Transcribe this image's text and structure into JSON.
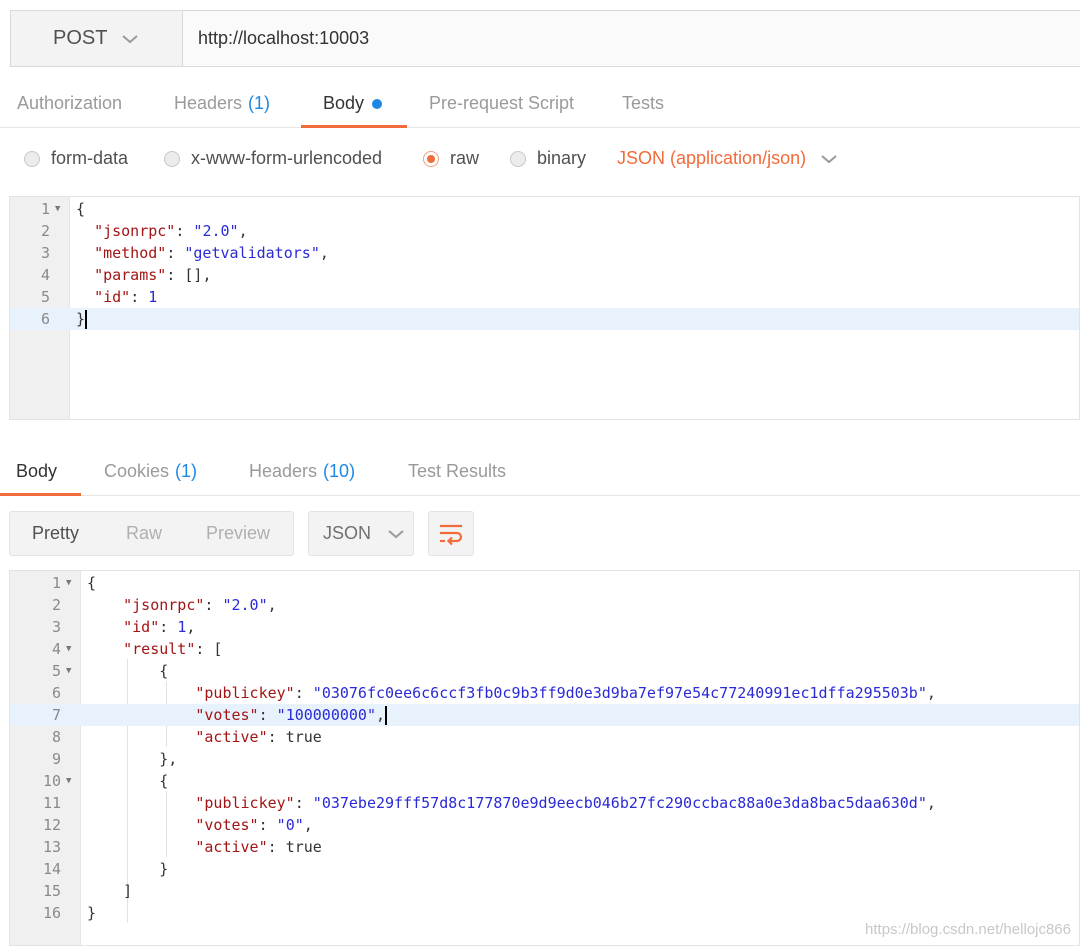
{
  "request": {
    "method": "POST",
    "url": "http://localhost:10003",
    "tabs": [
      {
        "label": "Authorization",
        "count": ""
      },
      {
        "label": "Headers",
        "count": "(1)"
      },
      {
        "label": "Body",
        "count": ""
      },
      {
        "label": "Pre-request Script",
        "count": ""
      },
      {
        "label": "Tests",
        "count": ""
      }
    ],
    "active_tab": "Body",
    "body_types": [
      "form-data",
      "x-www-form-urlencoded",
      "raw",
      "binary"
    ],
    "selected_body_type": "raw",
    "content_type": "JSON (application/json)",
    "body_lines": [
      "1",
      "2",
      "3",
      "4",
      "5",
      "6"
    ]
  },
  "response": {
    "tabs": [
      {
        "label": "Body",
        "count": ""
      },
      {
        "label": "Cookies",
        "count": "(1)"
      },
      {
        "label": "Headers",
        "count": "(10)"
      },
      {
        "label": "Test Results",
        "count": ""
      }
    ],
    "active_tab": "Body",
    "view_modes": [
      "Pretty",
      "Raw",
      "Preview"
    ],
    "active_view": "Pretty",
    "format": "JSON",
    "body_lines": [
      "1",
      "2",
      "3",
      "4",
      "5",
      "6",
      "7",
      "8",
      "9",
      "10",
      "11",
      "12",
      "13",
      "14",
      "15",
      "16"
    ],
    "values": {
      "jsonrpc": "2.0",
      "id": "1",
      "validators": [
        {
          "publickey": "03076fc0ee6c6ccf3fb0c9b3ff9d0e3d9ba7ef97e54c77240991ec1dffa295503b",
          "votes": "100000000",
          "active": "true"
        },
        {
          "publickey": "037ebe29fff57d8c177870e9d9eecb046b27fc290ccbac88a0e3da8bac5daa630d",
          "votes": "0",
          "active": "true"
        }
      ]
    }
  },
  "request_body": {
    "jsonrpc": "2.0",
    "method": "getvalidators",
    "params": "[]",
    "id": "1"
  },
  "watermark": "https://blog.csdn.net/hellojc866",
  "colors": {
    "accent": "#f26b3a",
    "link": "#1e88e5",
    "string": "#2a2ad6",
    "key": "#a31515"
  }
}
